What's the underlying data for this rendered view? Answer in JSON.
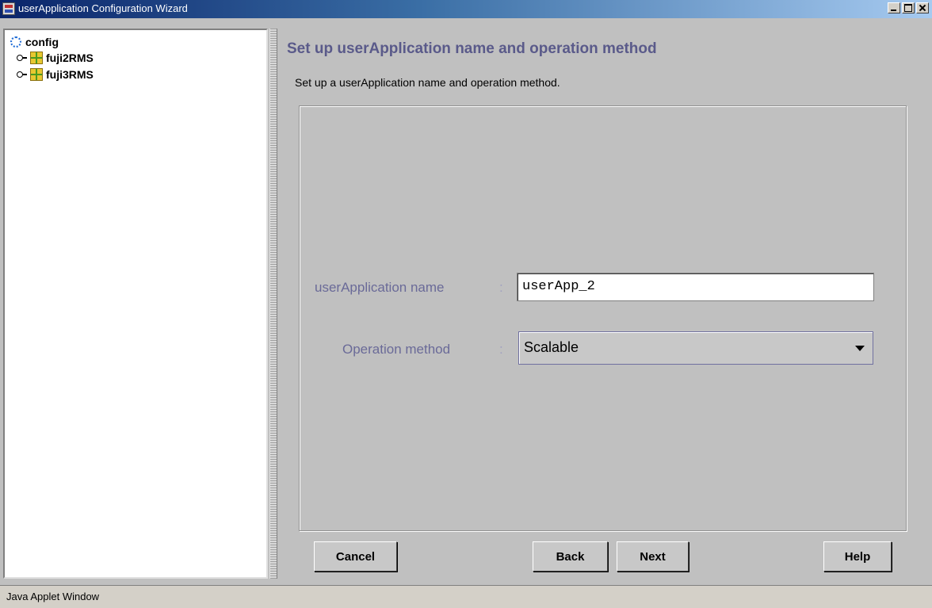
{
  "window": {
    "title": "userApplication Configuration Wizard",
    "icon": "java-app-icon"
  },
  "tree": {
    "root": {
      "label": "config",
      "icon": "config-icon"
    },
    "nodes": [
      {
        "label": "fuji2RMS",
        "icon": "node-icon"
      },
      {
        "label": "fuji3RMS",
        "icon": "node-icon"
      }
    ]
  },
  "page": {
    "title": "Set up userApplication name and operation method",
    "description": "Set up a userApplication name and operation method."
  },
  "form": {
    "name_label": "userApplication name",
    "name_value": "userApp_2",
    "method_label": "Operation method",
    "method_value": "Scalable",
    "separator": ":"
  },
  "buttons": {
    "cancel": "Cancel",
    "back": "Back",
    "next": "Next",
    "help": "Help"
  },
  "status": {
    "text": "Java Applet Window"
  }
}
